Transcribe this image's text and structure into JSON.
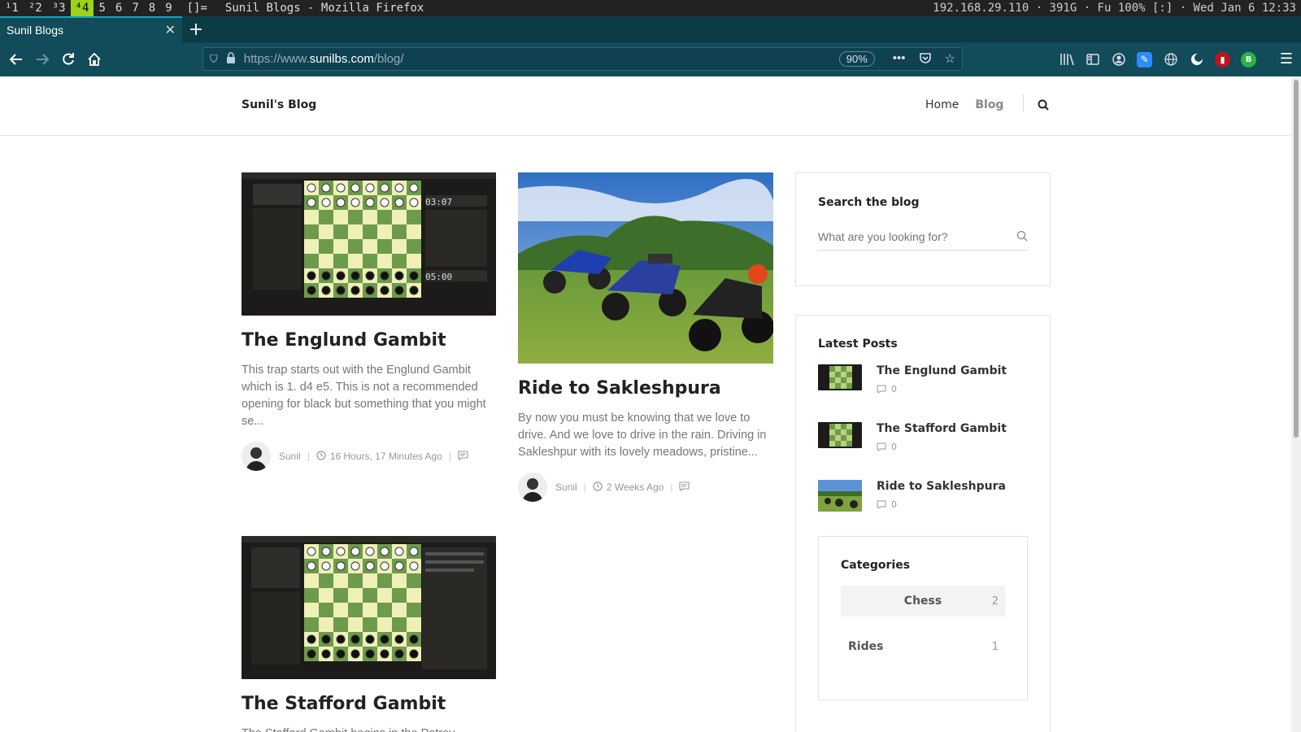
{
  "statusbar": {
    "workspaces": [
      "¹1",
      "²2",
      "³3",
      "⁴4",
      "5",
      "6",
      "7",
      "8",
      "9"
    ],
    "active_workspace": "⁴4",
    "layout": "[]=",
    "window_title": "Sunil Blogs - Mozilla Firefox",
    "status": "192.168.29.110 · 391G · Fu 100% [:] · Wed Jan  6 12:33"
  },
  "browser": {
    "tab_title": "Sunil Blogs",
    "url_prefix": "https://www.",
    "url_host": "sunilbs.com",
    "url_path": "/blog/",
    "zoom": "90%"
  },
  "site": {
    "brand": "Sunil's Blog",
    "nav": {
      "home": "Home",
      "blog": "Blog"
    }
  },
  "posts": [
    {
      "title": "The Englund Gambit",
      "excerpt": "This trap starts out with the Englund Gambit which is 1. d4 e5. This is not a recommended opening for black but something that you might se...",
      "author": "Sunil",
      "time": "16 Hours, 17 Minutes Ago"
    },
    {
      "title": "Ride to Sakleshpura",
      "excerpt": "By now you must be knowing that we love to drive. And we love to drive in the rain. Driving in Sakleshpur with its lovely meadows, pristine...",
      "author": "Sunil",
      "time": "2 Weeks Ago"
    },
    {
      "title": "The Stafford Gambit",
      "excerpt": "The Stafford Gambit begins in the Petrov..."
    }
  ],
  "sidebar": {
    "search_title": "Search the blog",
    "search_placeholder": "What are you looking for?",
    "latest_title": "Latest Posts",
    "latest": [
      {
        "title": "The Englund Gambit",
        "comments": "0"
      },
      {
        "title": "The Stafford Gambit",
        "comments": "0"
      },
      {
        "title": "Ride to Sakleshpura",
        "comments": "0"
      }
    ],
    "categories_title": "Categories",
    "categories": [
      {
        "name": "Chess",
        "count": "2"
      },
      {
        "name": "Rides",
        "count": "1"
      }
    ]
  },
  "chess_clock": {
    "top": "03:07",
    "bottom": "05:00"
  },
  "colors": {
    "active_workspace": "#9bd21a",
    "browser_bg": "#124b59",
    "board_light": "#eef0b8",
    "board_dark": "#6e9a4c"
  }
}
